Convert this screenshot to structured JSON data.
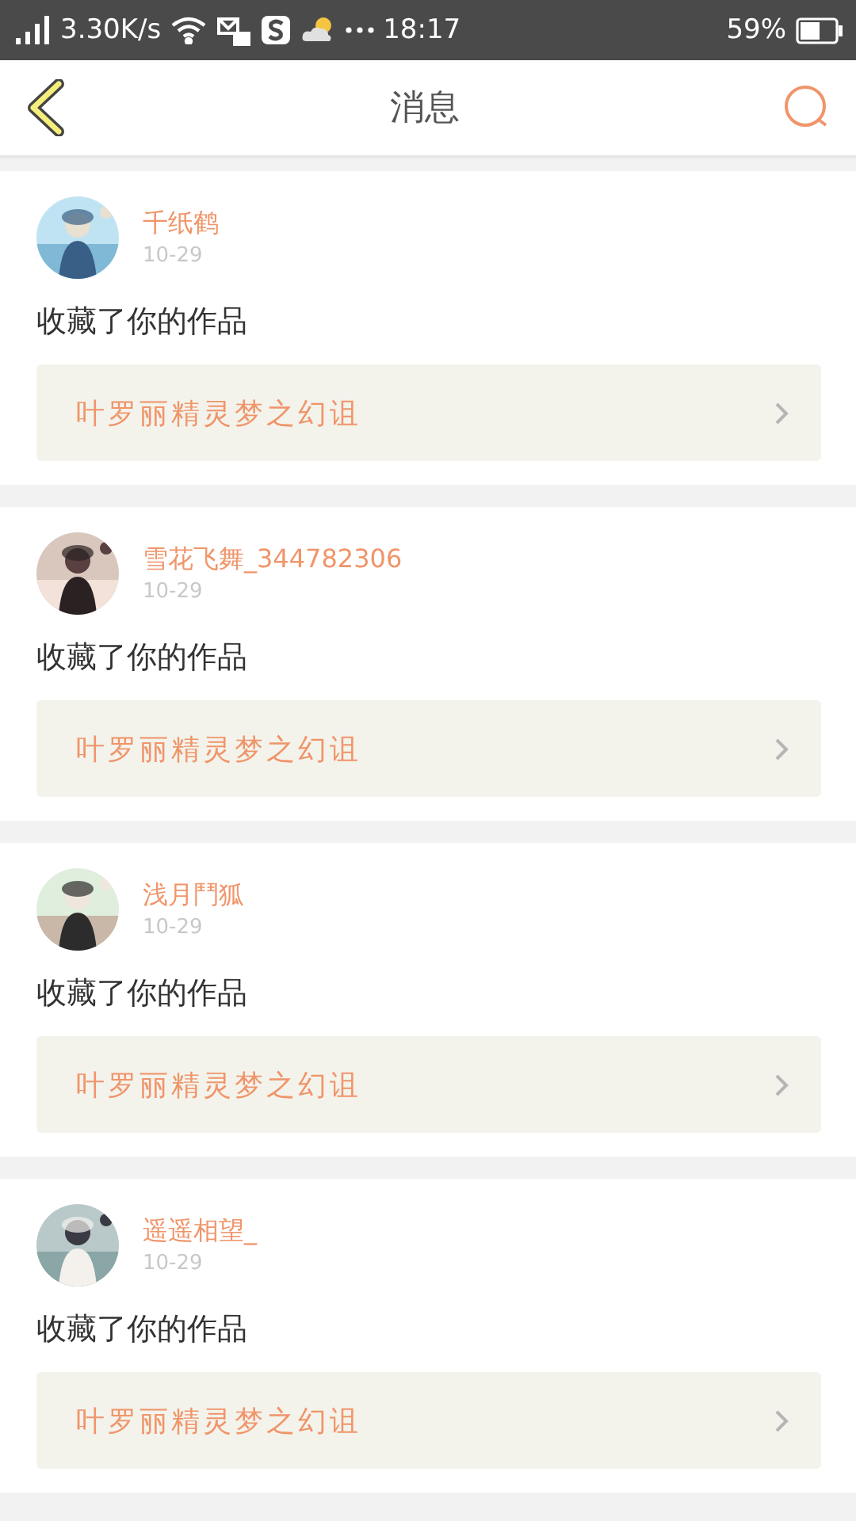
{
  "status_bar": {
    "speed": "3.30K/s",
    "time": "18:17",
    "battery": "59%"
  },
  "nav": {
    "title": "消息"
  },
  "messages": [
    {
      "name": "千纸鹤",
      "date": "10-29",
      "action": "收藏了你的作品",
      "work": "叶罗丽精灵梦之幻诅"
    },
    {
      "name": "雪花飞舞_344782306",
      "date": "10-29",
      "action": "收藏了你的作品",
      "work": "叶罗丽精灵梦之幻诅"
    },
    {
      "name": "浅月鬥狐",
      "date": "10-29",
      "action": "收藏了你的作品",
      "work": "叶罗丽精灵梦之幻诅"
    },
    {
      "name": "遥遥相望_",
      "date": "10-29",
      "action": "收藏了你的作品",
      "work": "叶罗丽精灵梦之幻诅"
    }
  ]
}
